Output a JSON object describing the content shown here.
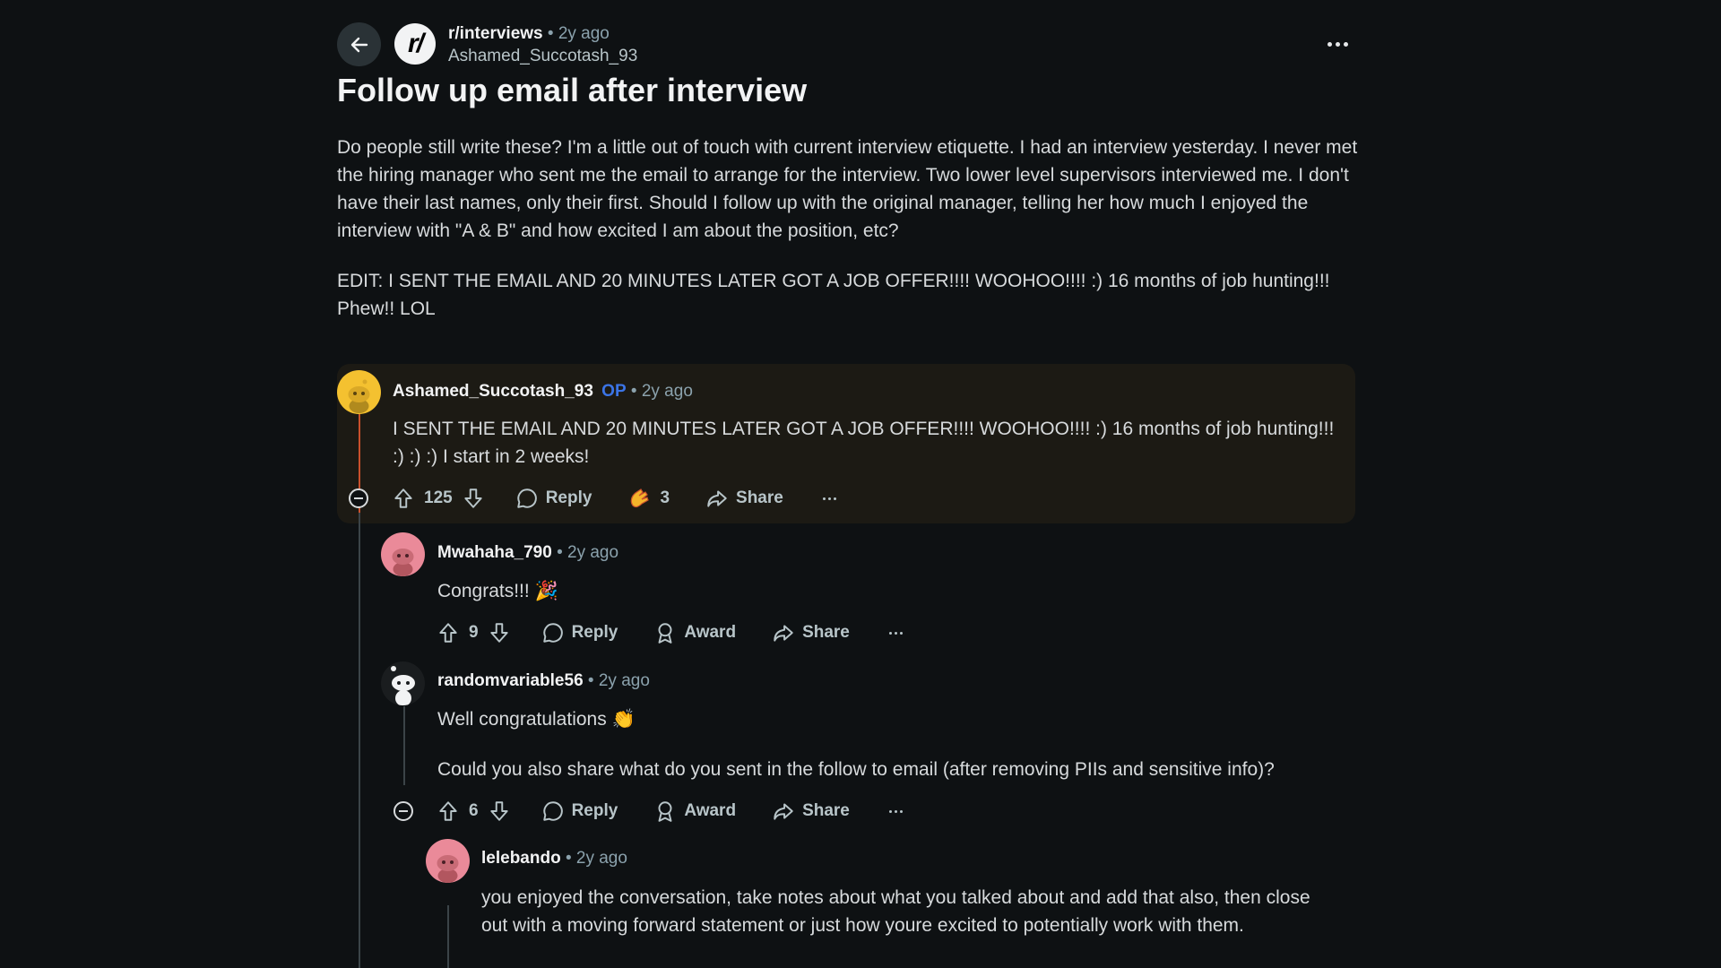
{
  "post": {
    "subreddit": "r/interviews",
    "age": "• 2y ago",
    "author": "Ashamed_Succotash_93",
    "title": "Follow up email after interview",
    "body": [
      "Do people still write these? I'm a little out of touch with current interview etiquette. I had an interview yesterday. I never met the hiring manager who sent me the email to arrange for the interview. Two lower level supervisors interviewed me. I don't have their last names, only their first. Should I follow up with the original manager, telling her how much I enjoyed the interview with \"A & B\" and how excited I am about the position, etc?",
      "EDIT: I SENT THE EMAIL AND 20 MINUTES LATER GOT A JOB OFFER!!!! WOOHOO!!!! :) 16 months of job hunting!!! Phew!! LOL"
    ]
  },
  "comments": [
    {
      "author": "Ashamed_Succotash_93",
      "op_tag": "OP",
      "age": "• 2y ago",
      "text": "I SENT THE EMAIL AND 20 MINUTES LATER GOT A JOB OFFER!!!! WOOHOO!!!! :) 16 months of job hunting!!! :) :) :) I start in 2 weeks!",
      "votes": "125",
      "reply_label": "Reply",
      "award_count": "3",
      "share_label": "Share"
    },
    {
      "author": "Mwahaha_790",
      "age": "• 2y ago",
      "text": "Congrats!!! 🎉",
      "votes": "9",
      "reply_label": "Reply",
      "award_label": "Award",
      "share_label": "Share"
    },
    {
      "author": "randomvariable56",
      "age": "• 2y ago",
      "text": "Well congratulations 👏",
      "text2": "Could you also share what do you sent in the follow to email (after removing PIIs and sensitive info)?",
      "votes": "6",
      "reply_label": "Reply",
      "award_label": "Award",
      "share_label": "Share"
    },
    {
      "author": "lelebando",
      "age": "• 2y ago",
      "text": "you enjoyed the conversation, take notes about what you talked about and add that also, then close out with a moving forward statement or just how youre excited to potentially work with them."
    }
  ],
  "icons": {
    "back": "arrow-left-icon",
    "more": "ellipsis-icon",
    "upvote": "arrow-up-icon",
    "downvote": "arrow-down-icon",
    "reply": "speech-bubble-icon",
    "award": "award-ribbon-icon",
    "share": "share-arrow-icon",
    "collapse": "minus-circle-icon"
  },
  "colors": {
    "background": "#0e1113",
    "op_thread": "#c9502c",
    "op_tag": "#3b74e6",
    "highlight": "#1c1a14"
  }
}
